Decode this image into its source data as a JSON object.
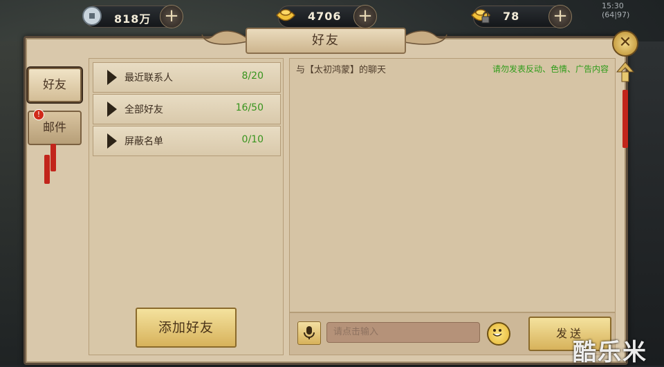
{
  "top_bar": {
    "currencies": [
      {
        "icon": "copper-coin-icon",
        "value": "818万"
      },
      {
        "icon": "gold-ingot-icon",
        "value": "4706"
      },
      {
        "icon": "locked-gold-ingot-icon",
        "value": "78"
      }
    ],
    "time": "15:30",
    "ping": "(64|97)"
  },
  "panel": {
    "title": "好友"
  },
  "side_tabs": [
    {
      "label": "好友",
      "active": true
    },
    {
      "label": "邮件",
      "active": false,
      "badge": "!"
    }
  ],
  "categories": [
    {
      "label": "最近联系人",
      "count": "8/20"
    },
    {
      "label": "全部好友",
      "count": "16/50"
    },
    {
      "label": "屏蔽名单",
      "count": "0/10"
    }
  ],
  "add_friend_label": "添加好友",
  "chat": {
    "title": "与【太初鸿蒙】的聊天",
    "warning": "请勿发表反动、色情、广告内容",
    "input_placeholder": "请点击输入",
    "send_label": "发送"
  },
  "watermark": "酷乐米",
  "colors": {
    "panel_bg": "#d9c8ab",
    "count_green": "#37941d",
    "button_gold": "#d7b25b"
  }
}
